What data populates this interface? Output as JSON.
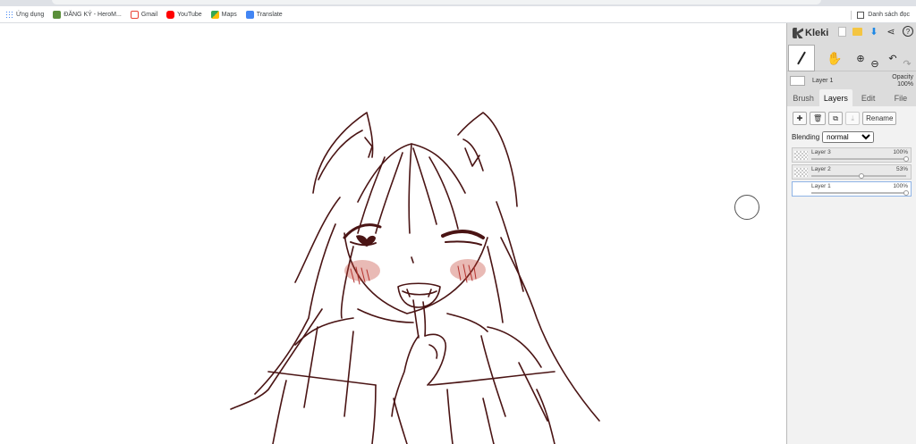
{
  "bookmarks": [
    {
      "label": "Ứng dụng",
      "icon": "apps-grid-icon",
      "color": "#4285f4"
    },
    {
      "label": "ĐĂNG KÝ - HeroM...",
      "icon": "site-favicon-icon",
      "color": "#5a8f3a"
    },
    {
      "label": "Gmail",
      "icon": "gmail-icon",
      "color": "#ea4335"
    },
    {
      "label": "YouTube",
      "icon": "youtube-icon",
      "color": "#ff0000"
    },
    {
      "label": "Maps",
      "icon": "maps-icon",
      "color": "#34a853"
    },
    {
      "label": "Translate",
      "icon": "translate-icon",
      "color": "#4285f4"
    }
  ],
  "reading_list": "Danh sách đọc",
  "app": {
    "name": "Kleki",
    "accent": "#1e88e5"
  },
  "current_layer": {
    "name": "Layer 1",
    "opacity_label": "Opacity",
    "opacity_value": "100%"
  },
  "tabs": [
    "Brush",
    "Layers",
    "Edit",
    "File"
  ],
  "active_tab": "Layers",
  "layer_buttons": {
    "rename": "Rename"
  },
  "blending": {
    "label": "Blending",
    "value": "normal"
  },
  "layers": [
    {
      "name": "Layer 3",
      "opacity": "100%",
      "level": 1.0,
      "active": false
    },
    {
      "name": "Layer 2",
      "opacity": "53%",
      "level": 0.53,
      "active": false
    },
    {
      "name": "Layer 1",
      "opacity": "100%",
      "level": 1.0,
      "active": true
    }
  ],
  "drawing_colors": {
    "line": "#4a1414",
    "blush": "#c0392b"
  }
}
